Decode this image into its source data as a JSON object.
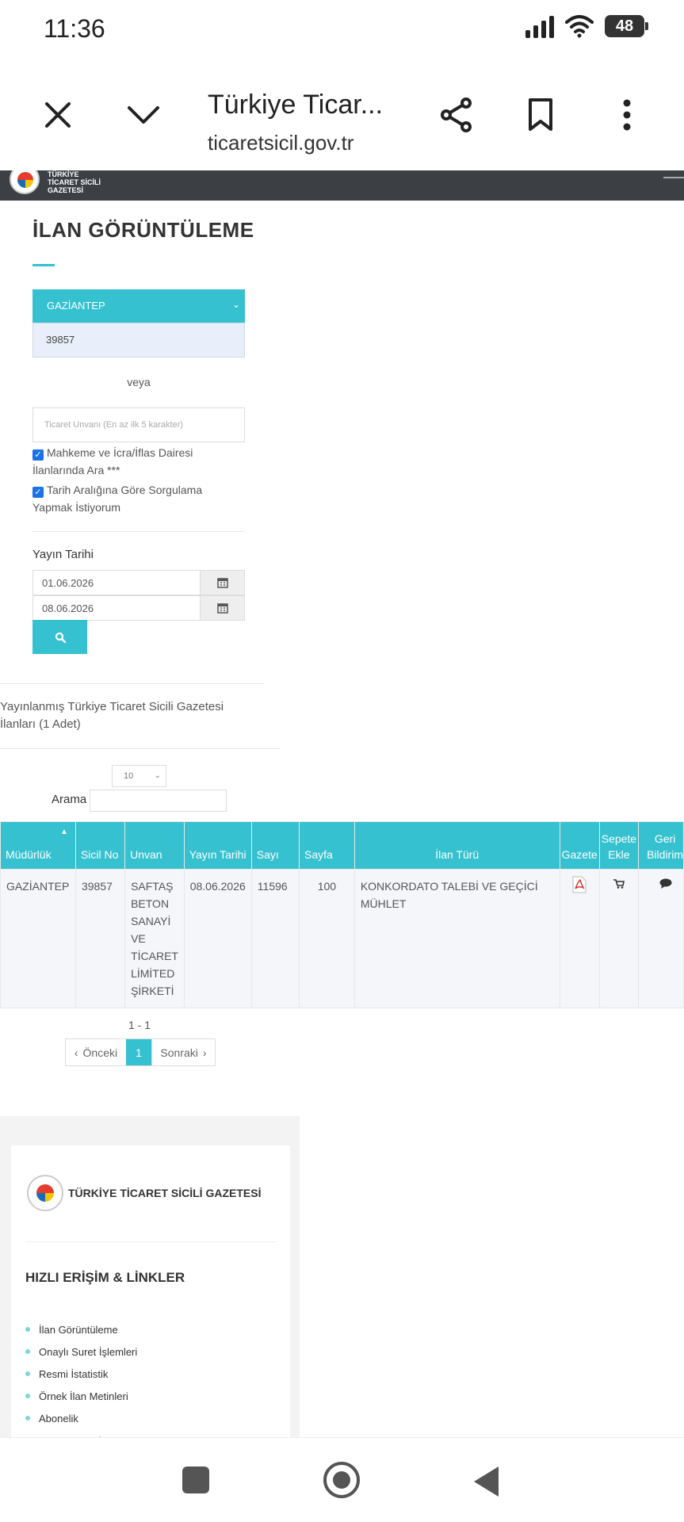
{
  "status_bar": {
    "time": "11:36",
    "battery": "48"
  },
  "browser": {
    "title": "Türkiye Ticar...",
    "url": "ticaretsicil.gov.tr"
  },
  "site_header": {
    "line1": "TÜRKİYE",
    "line2": "TİCARET SİCİLİ",
    "line3": "GAZETESİ"
  },
  "form": {
    "page_title": "İLAN GÖRÜNTÜLEME",
    "mudurluk": "GAZİANTEP",
    "sicil_no": "39857",
    "veya": "veya",
    "unvan_placeholder": "Ticaret Unvanı (En az ilk 5 karakter)",
    "checkbox1": "Mahkeme ve İcra/İflas Dairesi İlanlarında Ara ***",
    "checkbox2": "Tarih Aralığına Göre Sorgulama Yapmak İstiyorum",
    "date_label": "Yayın Tarihi",
    "date_from": "01.06.2026",
    "date_to": "08.06.2026"
  },
  "results": {
    "summary": "Yayınlanmış Türkiye Ticaret Sicili Gazetesi İlanları (1 Adet)",
    "page_length": "10",
    "search_label": "Arama",
    "columns": [
      "Müdürlük",
      "Sicil No",
      "Unvan",
      "Yayın Tarihi",
      "Sayı",
      "Sayfa",
      "İlan Türü",
      "Gazete",
      "Sepete Ekle",
      "Geri Bildirim"
    ],
    "rows": [
      {
        "mudurluk": "GAZİANTEP",
        "sicil_no": "39857",
        "unvan": "SAFTAŞ BETON SANAYİ VE TİCARET LİMİTED ŞİRKETİ",
        "yayin_tarihi": "08.06.2026",
        "sayi": "11596",
        "sayfa": "100",
        "ilan_turu": "KONKORDATO TALEBİ VE GEÇİCİ MÜHLET"
      }
    ],
    "page_info": "1 - 1",
    "prev_label": "Önceki",
    "current_page": "1",
    "next_label": "Sonraki"
  },
  "footer": {
    "brand": "TÜRKİYE TİCARET SİCİLİ GAZETESİ",
    "heading": "HIZLI ERİŞİM & LİNKLER",
    "links": [
      "İlan Görüntüleme",
      "Onaylı Suret İşlemleri",
      "Resmi İstatistik",
      "Örnek İlan Metinleri",
      "Abonelik",
      "Unvan Sorgulama"
    ]
  }
}
